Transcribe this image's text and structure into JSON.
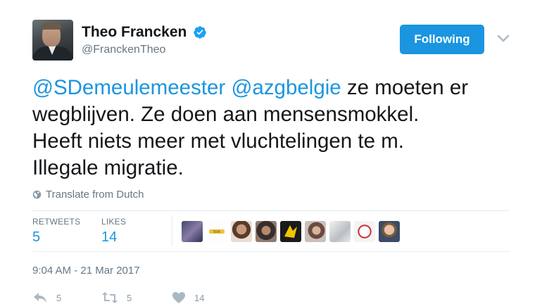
{
  "author": {
    "name": "Theo Francken",
    "handle": "@FranckenTheo",
    "verified": true
  },
  "follow_button": {
    "label": "Following"
  },
  "tweet": {
    "mentions": [
      "@SDemeulemeester",
      "@azgbelgie"
    ],
    "line1_rest": " ze moeten er",
    "line2": "wegblijven. Ze doen aan mensensmokkel.",
    "line3": "Heeft niets meer met vluchtelingen te m.",
    "line4": "Illegale migratie."
  },
  "translate": {
    "label": "Translate from Dutch",
    "icon": "globe-icon"
  },
  "stats": {
    "retweets_label": "RETWEETS",
    "retweets_value": "5",
    "likes_label": "LIKES",
    "likes_value": "14"
  },
  "timestamp": "9:04 AM - 21 Mar 2017",
  "actions": {
    "reply_count": "5",
    "retweet_count": "5",
    "like_count": "14"
  },
  "colors": {
    "accent": "#1b95e0",
    "muted": "#657786",
    "text": "#14171a"
  }
}
